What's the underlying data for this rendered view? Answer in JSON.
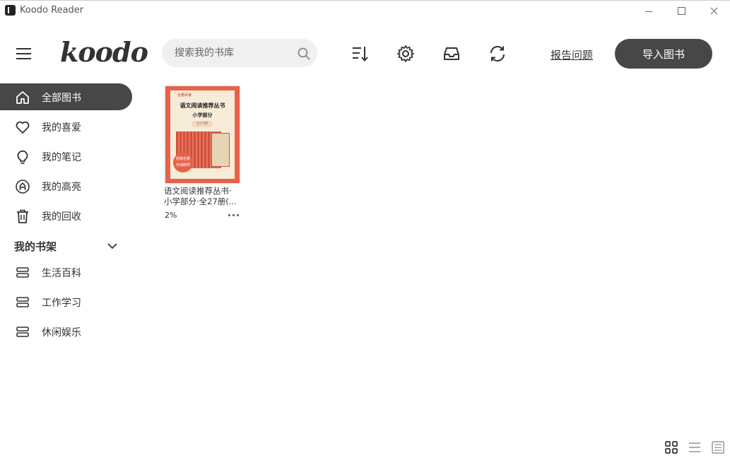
{
  "window": {
    "title": "Koodo Reader"
  },
  "header": {
    "logo": "koodo",
    "search_placeholder": "搜索我的书库",
    "report_label": "报告问题",
    "import_label": "导入图书"
  },
  "sidebar": {
    "items": [
      {
        "label": "全部图书",
        "icon": "home-icon",
        "active": true
      },
      {
        "label": "我的喜爱",
        "icon": "heart-icon"
      },
      {
        "label": "我的笔记",
        "icon": "bulb-icon"
      },
      {
        "label": "我的高亮",
        "icon": "highlight-icon"
      },
      {
        "label": "我的回收",
        "icon": "trash-icon"
      }
    ],
    "shelf_title": "我的书架",
    "shelves": [
      {
        "label": "生活百科"
      },
      {
        "label": "工作学习"
      },
      {
        "label": "休闲娱乐"
      }
    ]
  },
  "books": [
    {
      "title": "语文阅读推荐丛书·小学部分·全27册(...",
      "progress": "2%",
      "cover": {
        "small_text": "名著阅读",
        "title": "语文阅读推荐丛书",
        "subtitle": "小学部分",
        "volumes": "全27册",
        "badge_line1": "经典名著",
        "badge_line2": "开阔眼界"
      }
    }
  ],
  "colors": {
    "accent": "#474747",
    "cover": "#e8614b"
  }
}
